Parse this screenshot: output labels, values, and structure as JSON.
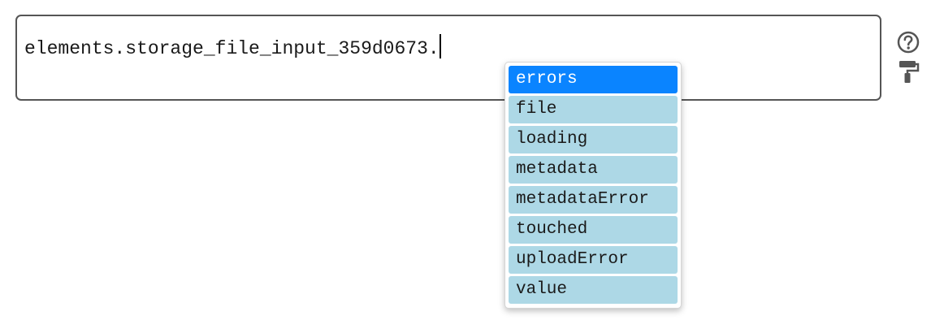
{
  "editor": {
    "text": "elements.storage_file_input_359d0673."
  },
  "autocomplete": {
    "selected_index": 0,
    "items": [
      {
        "label": "errors"
      },
      {
        "label": "file"
      },
      {
        "label": "loading"
      },
      {
        "label": "metadata"
      },
      {
        "label": "metadataError"
      },
      {
        "label": "touched"
      },
      {
        "label": "uploadError"
      },
      {
        "label": "value"
      }
    ]
  },
  "icons": {
    "help": "help-icon",
    "format": "paint-roller-icon"
  },
  "colors": {
    "selected_bg": "#0a84ff",
    "item_bg": "#add8e6",
    "border": "#555555",
    "icon": "#555555"
  }
}
